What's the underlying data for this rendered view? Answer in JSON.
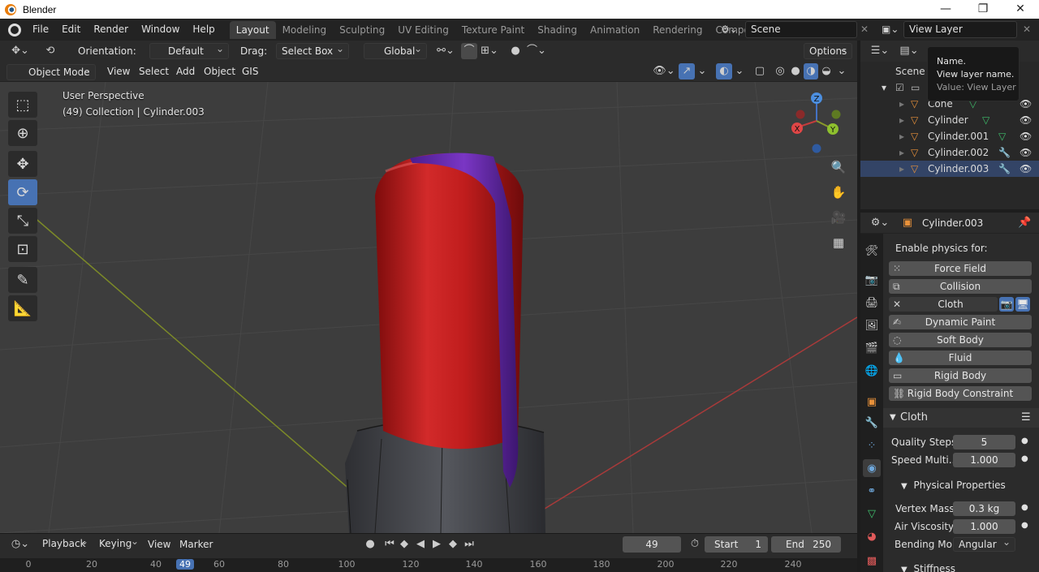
{
  "window": {
    "title": "Blender",
    "controls": [
      "—",
      "❐",
      "✕"
    ]
  },
  "menu": [
    "File",
    "Edit",
    "Render",
    "Window",
    "Help"
  ],
  "workspaces": [
    "Layout",
    "Modeling",
    "Sculpting",
    "UV Editing",
    "Texture Paint",
    "Shading",
    "Animation",
    "Rendering",
    "Compositing"
  ],
  "scene_name": "Scene",
  "view_layer_name": "View Layer",
  "tool_header": {
    "orientation_label": "Orientation:",
    "orientation_value": "Default",
    "drag_label": "Drag:",
    "drag_value": "Select Box",
    "transform_value": "Global",
    "options_label": "Options"
  },
  "viewport_header": {
    "mode": "Object Mode",
    "menus": [
      "View",
      "Select",
      "Add",
      "Object",
      "GIS"
    ]
  },
  "viewport": {
    "perspective": "User Perspective",
    "info": "(49) Collection | Cylinder.003",
    "gizmo": {
      "z": "Z",
      "x": "X",
      "y": "Y"
    },
    "colors": {
      "background": "#3d3d3d",
      "cylinder": "#c91f1f",
      "cloth": "#6a2fb0",
      "x_axis": "#c43c3c",
      "y_axis": "#8a9a2a"
    }
  },
  "timeline": {
    "menus": [
      "Playback",
      "Keying",
      "View",
      "Marker"
    ],
    "current_frame": "49",
    "start_label": "Start",
    "start": "1",
    "end_label": "End",
    "end": "250",
    "ruler": [
      "0",
      "20",
      "40",
      "49",
      "60",
      "80",
      "100",
      "120",
      "140",
      "160",
      "180",
      "200",
      "220",
      "240"
    ]
  },
  "outliner": {
    "scene_collection": "Scene C",
    "items": [
      {
        "name": "Cone",
        "modifier": ""
      },
      {
        "name": "Cylinder",
        "modifier": ""
      },
      {
        "name": "Cylinder.001",
        "modifier": ""
      },
      {
        "name": "Cylinder.002",
        "modifier": "wrench"
      },
      {
        "name": "Cylinder.003",
        "modifier": "wrench"
      }
    ]
  },
  "tooltip": {
    "title": "Name.",
    "desc": "View layer name.",
    "value": "Value: View Layer"
  },
  "properties": {
    "object_name": "Cylinder.003",
    "enable_physics_label": "Enable physics for:",
    "physics_buttons": [
      "Force Field",
      "Collision",
      "Cloth",
      "Dynamic Paint",
      "Soft Body",
      "Fluid",
      "Rigid Body",
      "Rigid Body Constraint"
    ],
    "cloth_section": "Cloth",
    "quality_steps_label": "Quality Steps",
    "quality_steps": "5",
    "speed_label": "Speed Multi...",
    "speed": "1.000",
    "physical_section": "Physical Properties",
    "vertex_mass_label": "Vertex Mass",
    "vertex_mass": "0.3 kg",
    "air_viscosity_label": "Air Viscosity",
    "air_viscosity": "1.000",
    "bending_label": "Bending Mo...",
    "bending": "Angular",
    "stiffness_section": "Stiffness"
  }
}
